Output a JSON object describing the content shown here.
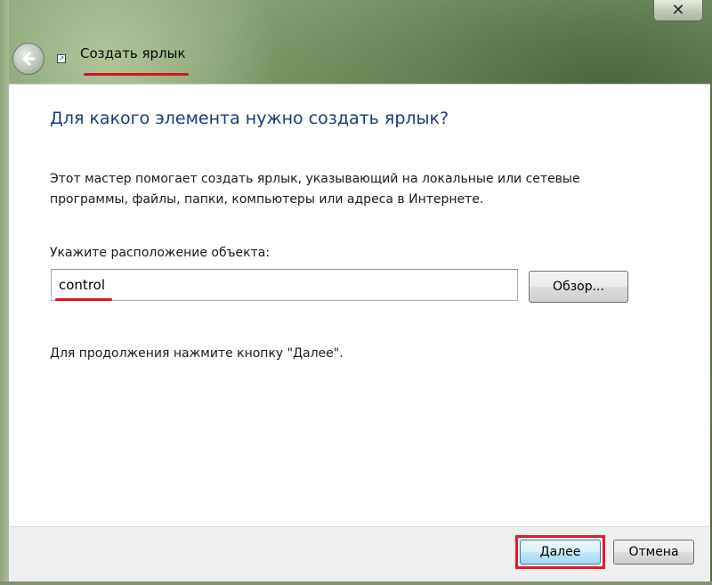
{
  "titlebar": {
    "title": "Создать ярлык",
    "close_glyph": "✕",
    "back_icon": "back-arrow-icon",
    "shortcut_icon": "shortcut-icon"
  },
  "main": {
    "heading": "Для какого элемента нужно создать ярлык?",
    "description": "Этот мастер помогает создать ярлык, указывающий на локальные или сетевые программы, файлы, папки, компьютеры или адреса в Интернете.",
    "location_label": "Укажите расположение объекта:",
    "location_value": "control",
    "browse_label": "Обзор...",
    "hint": "Для продолжения нажмите кнопку \"Далее\"."
  },
  "footer": {
    "next_label": "Далее",
    "cancel_label": "Отмена"
  },
  "colors": {
    "heading": "#1e3a78",
    "annotation_red": "#d8141a"
  }
}
